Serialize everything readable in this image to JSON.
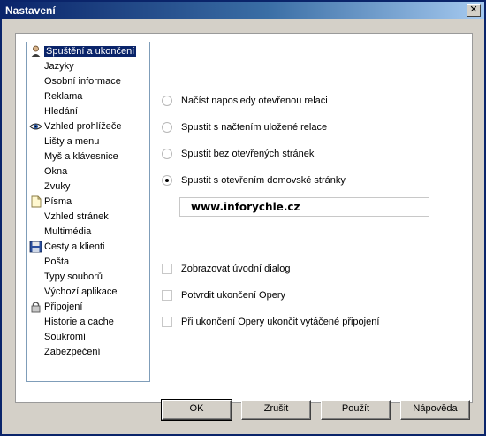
{
  "window": {
    "title": "Nastavení",
    "close_symbol": "✕"
  },
  "sidebar": {
    "items": [
      {
        "label": "Spuštění a ukončení",
        "icon": "person-icon",
        "selected": true
      },
      {
        "label": "Jazyky",
        "icon": ""
      },
      {
        "label": "Osobní informace",
        "icon": ""
      },
      {
        "label": "Reklama",
        "icon": ""
      },
      {
        "label": "Hledání",
        "icon": ""
      },
      {
        "label": "Vzhled prohlížeče",
        "icon": "eye-icon"
      },
      {
        "label": "Lišty a menu",
        "icon": ""
      },
      {
        "label": "Myš a klávesnice",
        "icon": ""
      },
      {
        "label": "Okna",
        "icon": ""
      },
      {
        "label": "Zvuky",
        "icon": ""
      },
      {
        "label": "Písma",
        "icon": "document-icon"
      },
      {
        "label": "Vzhled stránek",
        "icon": ""
      },
      {
        "label": "Multimédia",
        "icon": ""
      },
      {
        "label": "Cesty a klienti",
        "icon": "floppy-disk-icon"
      },
      {
        "label": "Pošta",
        "icon": ""
      },
      {
        "label": "Typy souborů",
        "icon": ""
      },
      {
        "label": "Výchozí aplikace",
        "icon": ""
      },
      {
        "label": "Připojení",
        "icon": "padlock-icon"
      },
      {
        "label": "Historie a cache",
        "icon": ""
      },
      {
        "label": "Soukromí",
        "icon": ""
      },
      {
        "label": "Zabezpečení",
        "icon": ""
      }
    ]
  },
  "startup": {
    "options": [
      {
        "label": "Načíst naposledy otevřenou relaci",
        "checked": false
      },
      {
        "label": "Spustit s načtením uložené relace",
        "checked": false
      },
      {
        "label": "Spustit bez otevřených stránek",
        "checked": false
      },
      {
        "label": "Spustit s otevřením domovské stránky",
        "checked": true
      }
    ],
    "homepage_value": "www.inforychle.cz"
  },
  "checkboxes": [
    {
      "label": "Zobrazovat úvodní dialog",
      "checked": false
    },
    {
      "label": "Potvrdit ukončení Opery",
      "checked": false
    },
    {
      "label": "Při ukončení Opery ukončit vytáčené připojení",
      "checked": false
    }
  ],
  "buttons": {
    "ok": "OK",
    "cancel": "Zrušit",
    "apply": "Použít",
    "help": "Nápověda"
  }
}
